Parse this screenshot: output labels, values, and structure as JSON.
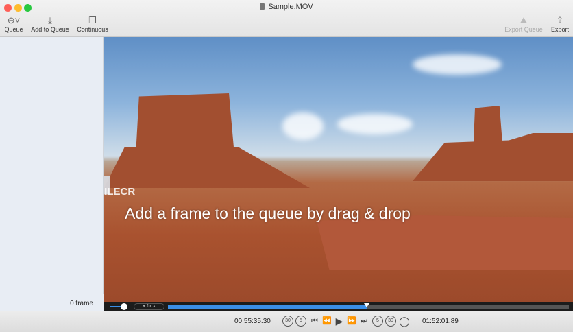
{
  "window": {
    "title": "Sample.MOV"
  },
  "toolbar": {
    "queue": "Queue",
    "add_to_queue": "Add to Queue",
    "continuous": "Continuous",
    "export_queue": "Export Queue",
    "export": "Export"
  },
  "sidebar": {
    "frame_count": "0 frame"
  },
  "video": {
    "overlay_text": "Add a frame to the queue by drag & drop",
    "watermark": "FILECR"
  },
  "controls": {
    "speed": "1x",
    "volume": 0.9,
    "progress": 0.496,
    "current_time": "00:55:35.30",
    "total_time": "01:52:01.89",
    "skip_30": "30",
    "skip_5": "5"
  },
  "colors": {
    "accent": "#3a8ee6"
  }
}
